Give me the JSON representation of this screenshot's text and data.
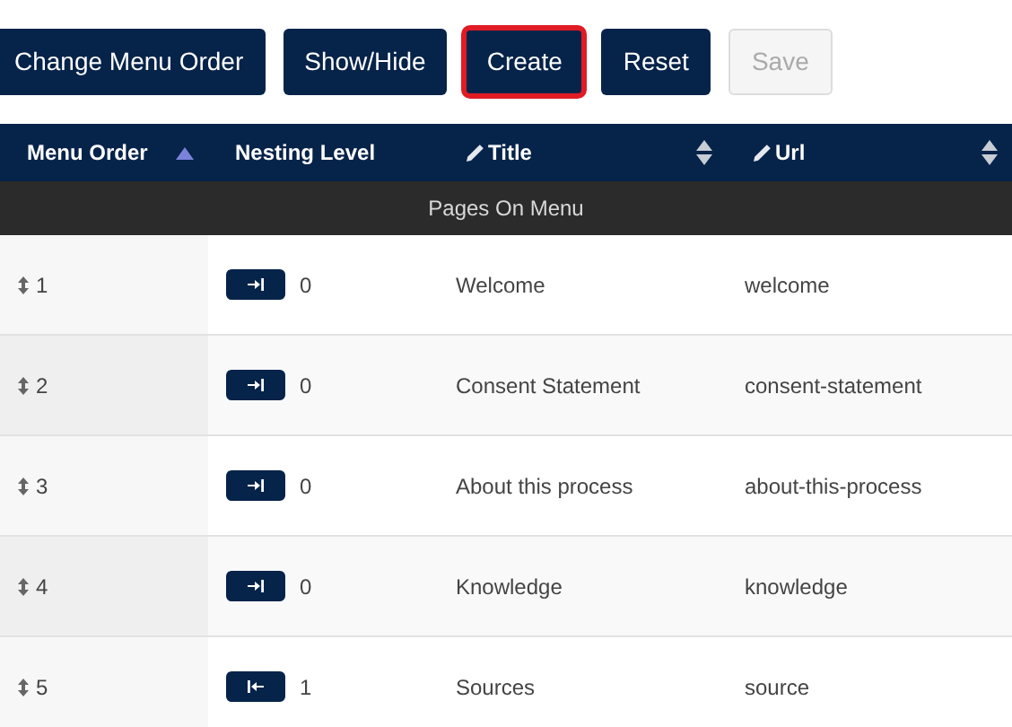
{
  "toolbar": [
    {
      "label": "Change Menu Order",
      "highlighted": false,
      "disabled": false
    },
    {
      "label": "Show/Hide",
      "highlighted": false,
      "disabled": false
    },
    {
      "label": "Create",
      "highlighted": true,
      "disabled": false
    },
    {
      "label": "Reset",
      "highlighted": false,
      "disabled": false
    },
    {
      "label": "Save",
      "highlighted": false,
      "disabled": true
    }
  ],
  "table": {
    "columns": [
      {
        "label": "Menu Order",
        "editable": false,
        "sorted": true,
        "sortable": true
      },
      {
        "label": "Nesting Level",
        "editable": false,
        "sorted": false,
        "sortable": false
      },
      {
        "label": "Title",
        "editable": true,
        "sorted": false,
        "sortable": true
      },
      {
        "label": "Url",
        "editable": true,
        "sorted": false,
        "sortable": true
      }
    ],
    "group": "Pages On Menu",
    "rows": [
      {
        "order": "1",
        "indent": true,
        "level": "0",
        "title": "Welcome",
        "url": "welcome"
      },
      {
        "order": "2",
        "indent": true,
        "level": "0",
        "title": "Consent Statement",
        "url": "consent-statement"
      },
      {
        "order": "3",
        "indent": true,
        "level": "0",
        "title": "About this process",
        "url": "about-this-process"
      },
      {
        "order": "4",
        "indent": true,
        "level": "0",
        "title": "Knowledge",
        "url": "knowledge"
      },
      {
        "order": "5",
        "indent": false,
        "level": "1",
        "title": "Sources",
        "url": "source"
      }
    ]
  }
}
